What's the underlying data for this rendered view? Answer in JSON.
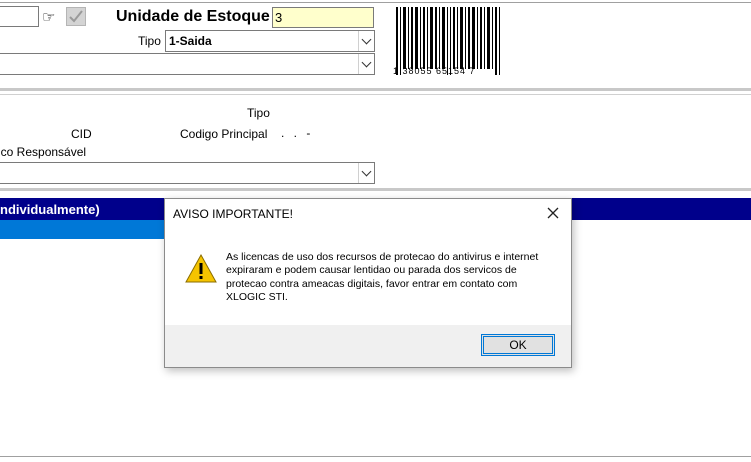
{
  "form": {
    "stock_unit_label": "Unidade de Estoque",
    "stock_unit_value": "3",
    "tipo_label": "Tipo",
    "tipo_value": "1-Saida",
    "barcode_number": "1 38055 65154 7",
    "section_tipo_label": "Tipo",
    "cid_label": "CID",
    "codigo_principal_label": "Codigo Principal",
    "codigo_principal_value": ". . -",
    "responsavel_label": "ico Responsável"
  },
  "grid": {
    "header_text": "ndividualmente)"
  },
  "dialog": {
    "title": "AVISO IMPORTANTE!",
    "message": "As licencas de uso dos recursos de protecao do antivirus e internet expiraram e podem causar lentidao ou parada dos servicos de protecao contra ameacas digitais, favor entrar em contato com XLOGIC STI.",
    "ok_label": "OK"
  },
  "colors": {
    "grid_header": "#00008b",
    "grid_selection": "#0078d7",
    "field_highlight": "#ffffcc",
    "warning": "#f5c400"
  }
}
